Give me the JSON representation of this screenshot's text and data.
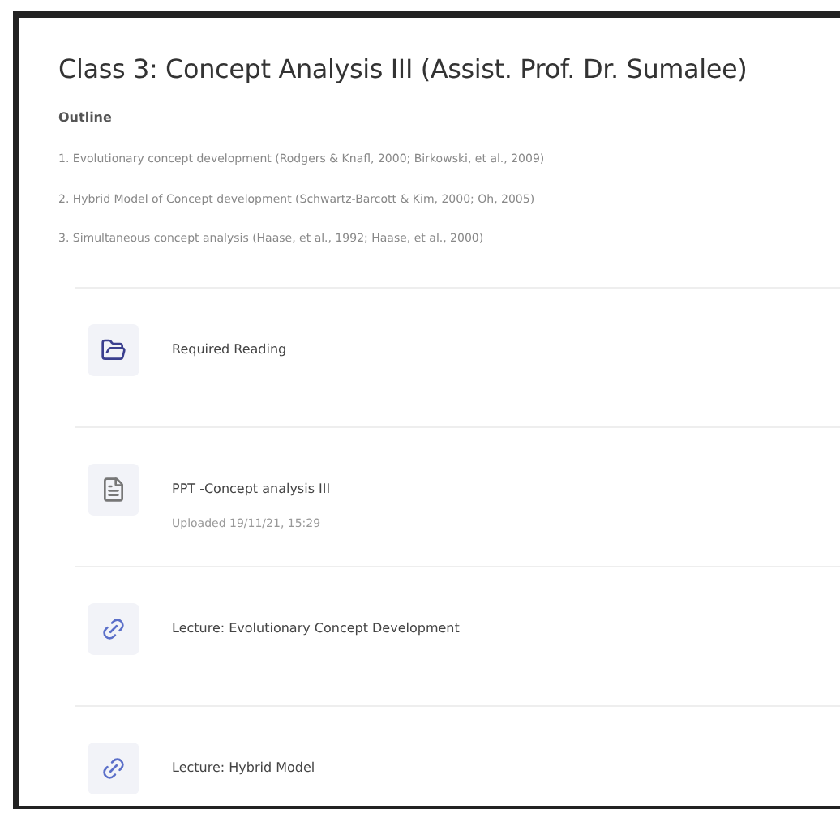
{
  "title": "Class 3: Concept Analysis III (Assist. Prof. Dr. Sumalee)",
  "outline": {
    "heading": "Outline",
    "items": [
      "1. Evolutionary concept development (Rodgers & Knafl, 2000; Birkowski, et al., 2009)",
      "2. Hybrid Model of Concept development (Schwartz-Barcott & Kim, 2000; Oh, 2005)",
      "3. Simultaneous concept analysis (Haase, et al., 1992; Haase, et al., 2000)"
    ]
  },
  "activities": [
    {
      "kind": "folder",
      "title": "Required Reading"
    },
    {
      "kind": "file",
      "title": "PPT -Concept analysis III",
      "subtitle": "Uploaded 19/11/21, 15:29"
    },
    {
      "kind": "link",
      "title": "Lecture: Evolutionary Concept Development"
    },
    {
      "kind": "link",
      "title": "Lecture: Hybrid Model"
    }
  ]
}
